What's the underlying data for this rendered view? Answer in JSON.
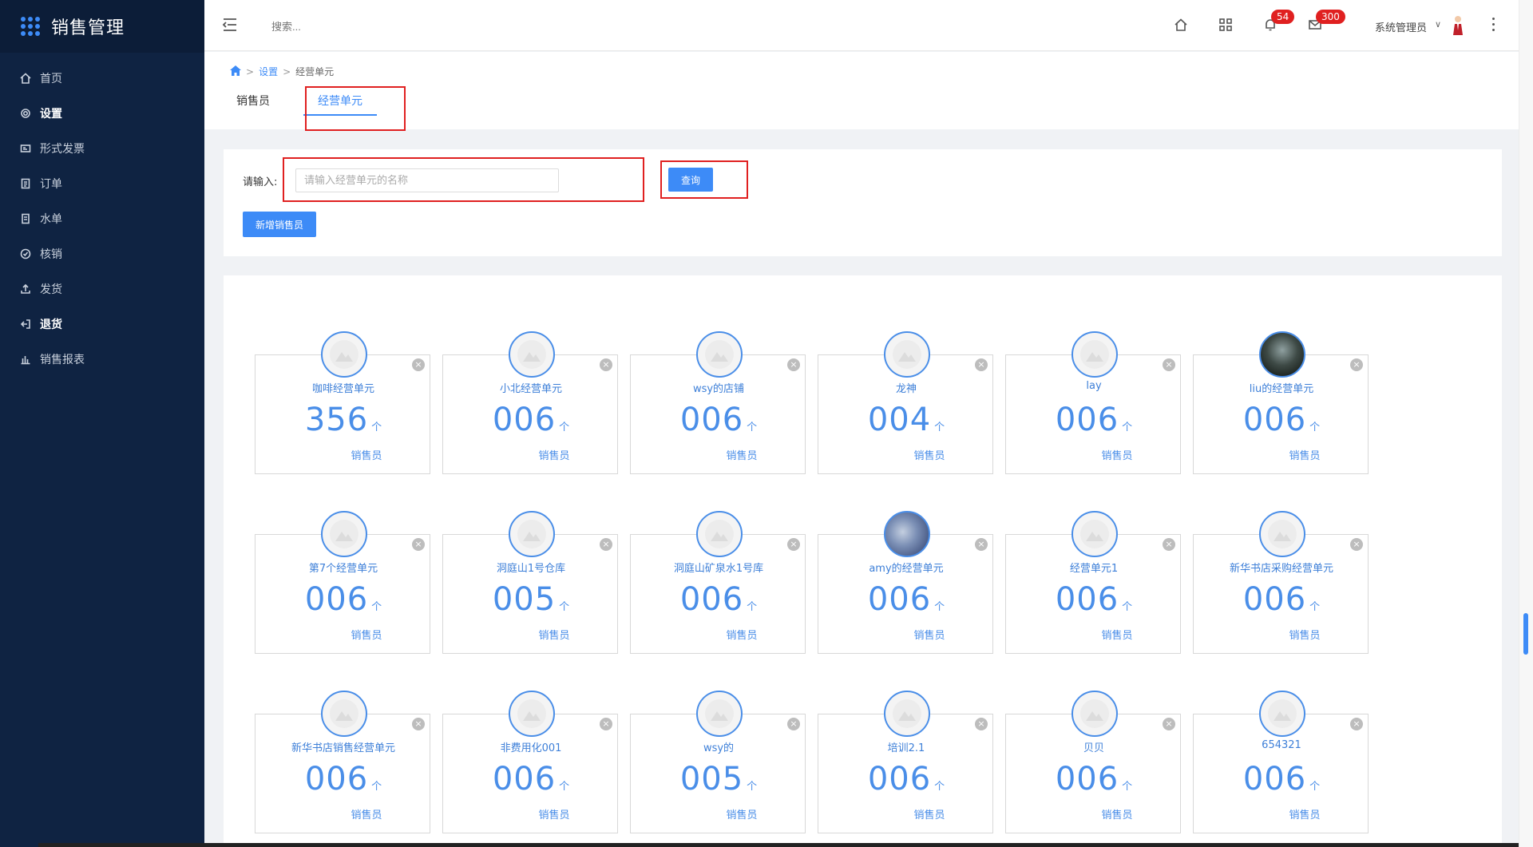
{
  "app": {
    "title": "销售管理"
  },
  "sidebar": {
    "items": [
      {
        "label": "首页",
        "icon": "home-icon"
      },
      {
        "label": "设置",
        "icon": "gear-icon"
      },
      {
        "label": "形式发票",
        "icon": "invoice-icon"
      },
      {
        "label": "订单",
        "icon": "order-icon"
      },
      {
        "label": "水单",
        "icon": "receipt-icon"
      },
      {
        "label": "核销",
        "icon": "check-circle-icon"
      },
      {
        "label": "发货",
        "icon": "upload-icon"
      },
      {
        "label": "退货",
        "icon": "return-icon"
      },
      {
        "label": "销售报表",
        "icon": "bar-chart-icon"
      }
    ]
  },
  "topbar": {
    "search_placeholder": "搜索...",
    "notifications": "54",
    "messages": "300",
    "user_name": "系统管理员"
  },
  "breadcrumb": {
    "level1": "设置",
    "level2": "经营单元"
  },
  "tabs": [
    {
      "label": "销售员"
    },
    {
      "label": "经营单元"
    }
  ],
  "search": {
    "label": "请输入:",
    "placeholder": "请输入经营单元的名称",
    "query_label": "查询",
    "add_label": "新增销售员"
  },
  "cards": [
    {
      "name": "咖啡经营单元",
      "count": "356",
      "unit": "个",
      "role": "销售员"
    },
    {
      "name": "小北经营单元",
      "count": "006",
      "unit": "个",
      "role": "销售员"
    },
    {
      "name": "wsy的店铺",
      "count": "006",
      "unit": "个",
      "role": "销售员"
    },
    {
      "name": "龙神",
      "count": "004",
      "unit": "个",
      "role": "销售员"
    },
    {
      "name": "lay",
      "count": "006",
      "unit": "个",
      "role": "销售员"
    },
    {
      "name": "liu的经营单元",
      "count": "006",
      "unit": "个",
      "role": "销售员"
    },
    {
      "name": "第7个经营单元",
      "count": "006",
      "unit": "个",
      "role": "销售员"
    },
    {
      "name": "洞庭山1号仓库",
      "count": "005",
      "unit": "个",
      "role": "销售员"
    },
    {
      "name": "洞庭山矿泉水1号库",
      "count": "006",
      "unit": "个",
      "role": "销售员"
    },
    {
      "name": "amy的经营单元",
      "count": "006",
      "unit": "个",
      "role": "销售员"
    },
    {
      "name": "经营单元1",
      "count": "006",
      "unit": "个",
      "role": "销售员"
    },
    {
      "name": "新华书店采购经营单元",
      "count": "006",
      "unit": "个",
      "role": "销售员"
    },
    {
      "name": "新华书店销售经营单元",
      "count": "006",
      "unit": "个",
      "role": "销售员"
    },
    {
      "name": "非费用化001",
      "count": "006",
      "unit": "个",
      "role": "销售员"
    },
    {
      "name": "wsy的",
      "count": "005",
      "unit": "个",
      "role": "销售员"
    },
    {
      "name": "培训2.1",
      "count": "006",
      "unit": "个",
      "role": "销售员"
    },
    {
      "name": "贝贝",
      "count": "006",
      "unit": "个",
      "role": "销售员"
    },
    {
      "name": "654321",
      "count": "006",
      "unit": "个",
      "role": "销售员"
    }
  ],
  "colors": {
    "sidebar": "#0f2342",
    "accent": "#3d8bf7",
    "highlight": "#e02020"
  }
}
